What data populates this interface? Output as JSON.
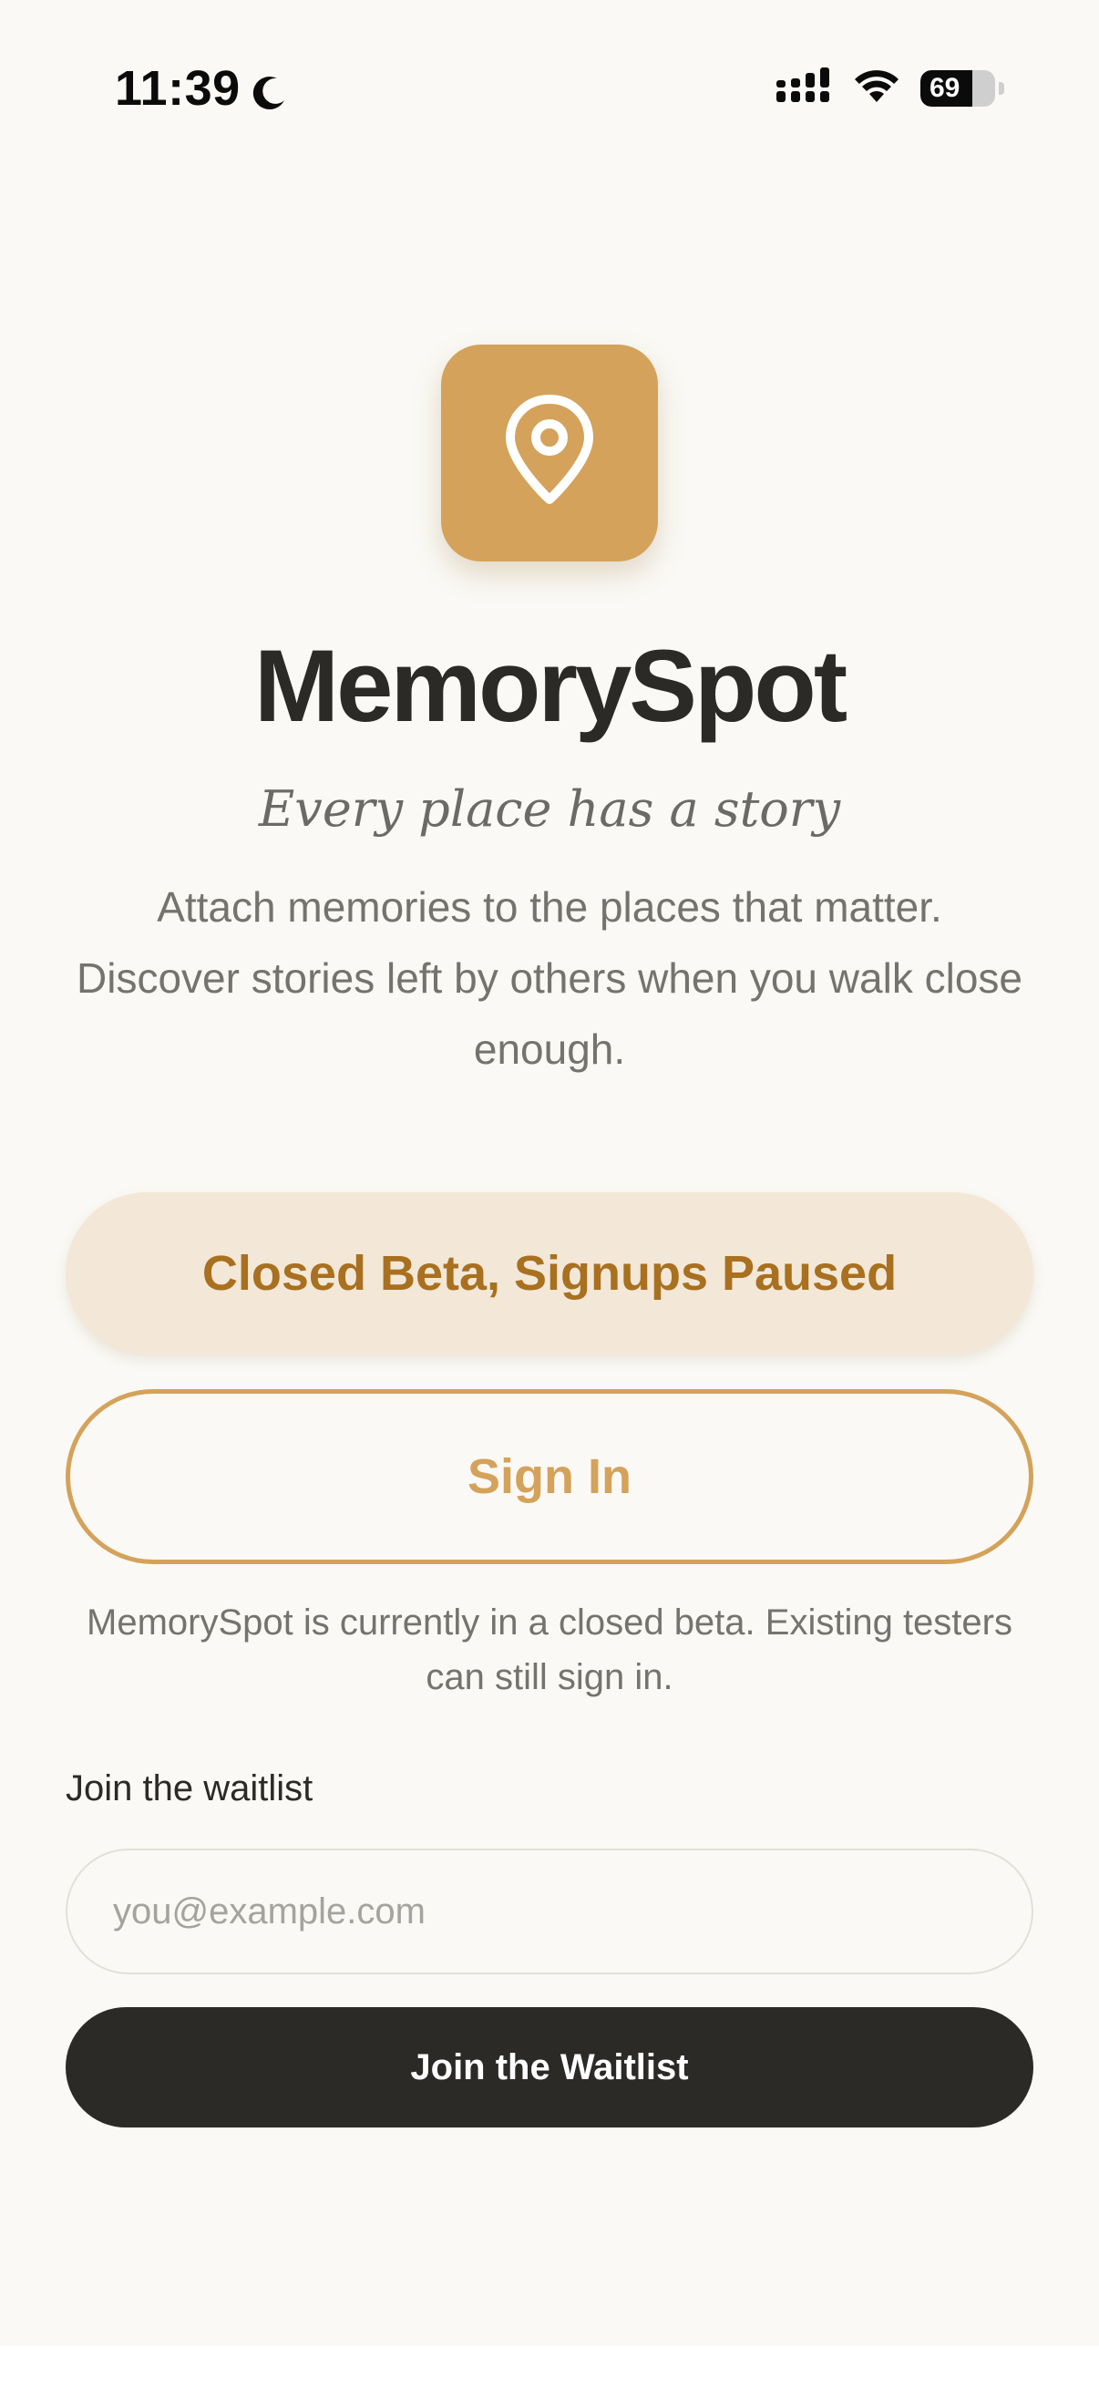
{
  "status_bar": {
    "time": "11:39",
    "battery_level": "69",
    "battery_fraction": 0.69
  },
  "app": {
    "name": "MemorySpot",
    "tagline": "Every place has a story",
    "description": "Attach memories to the places that matter. Discover stories left by others when you walk close enough."
  },
  "beta_banner": {
    "label": "Closed Beta, Signups Paused"
  },
  "sign_in": {
    "label": "Sign In",
    "note": "MemorySpot is currently in a closed beta. Existing testers can still sign in."
  },
  "waitlist": {
    "label": "Join the waitlist",
    "placeholder": "you@example.com",
    "button_label": "Join the Waitlist"
  },
  "colors": {
    "accent": "#d4a25a",
    "accent_dark": "#a8701f",
    "banner_bg": "#f3e7d7",
    "dark": "#2b2a27",
    "background": "#faf9f5"
  },
  "icons": {
    "app_icon": "map-pin-icon",
    "moon": "moon-icon",
    "signal": "cellular-signal-icon",
    "wifi": "wifi-icon",
    "battery": "battery-icon"
  }
}
